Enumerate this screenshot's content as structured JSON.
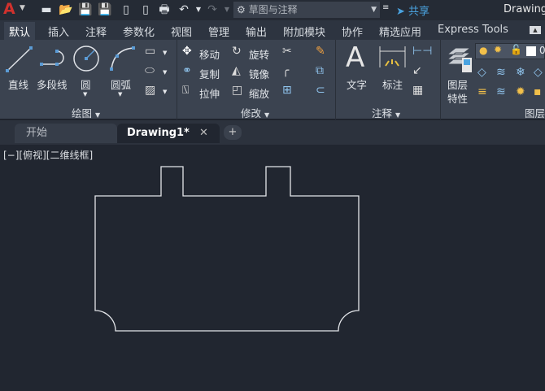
{
  "titlebar": {
    "app_icon": "autocad-a-logo",
    "quick_access": [
      "new-icon",
      "open-icon",
      "save-icon",
      "save-as-icon",
      "open-web-icon",
      "save-web-icon",
      "plot-icon",
      "undo-icon",
      "redo-icon"
    ],
    "workspace": "草图与注释",
    "share": "共享",
    "title": "Drawing"
  },
  "menu_tabs": [
    "默认",
    "插入",
    "注释",
    "参数化",
    "视图",
    "管理",
    "输出",
    "附加模块",
    "协作",
    "精选应用",
    "Express Tools"
  ],
  "ribbon": {
    "draw": {
      "label": "绘图",
      "line": "直线",
      "polyline": "多段线",
      "circle": "圆",
      "arc": "圆弧"
    },
    "modify": {
      "label": "修改",
      "move": "移动",
      "rotate": "旋转",
      "copy": "复制",
      "mirror": "镜像",
      "stretch": "拉伸",
      "scale": "缩放"
    },
    "annotation": {
      "label": "注释",
      "text": "文字",
      "dimension": "标注"
    },
    "layers": {
      "label": "图层",
      "properties_line1": "图层",
      "properties_line2": "特性",
      "layer_value": "0"
    }
  },
  "doc_tabs": {
    "start": "开始",
    "drawing": "Drawing1*"
  },
  "viewport": {
    "label": "[−][俯视][二维线框]"
  },
  "colors": {
    "canvas": "#212630",
    "ribbon": "#3b4350",
    "accent": "#4aa3e0",
    "logo": "#d0312d"
  }
}
